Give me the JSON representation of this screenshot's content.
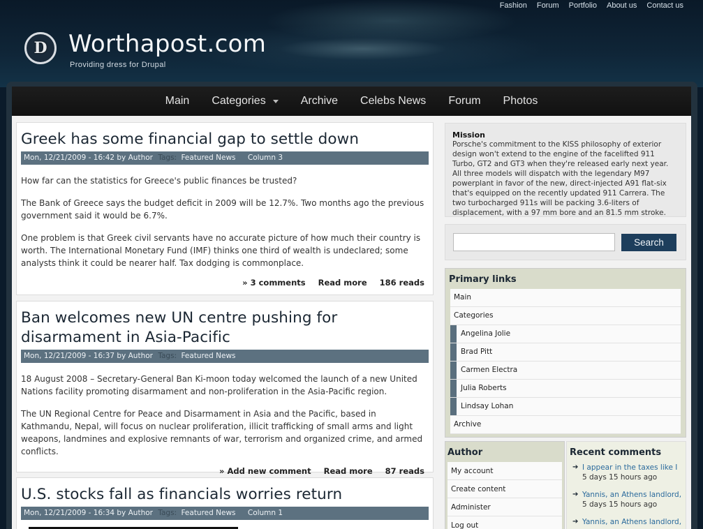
{
  "topnav": [
    "Fashion",
    "Forum",
    "Portfolio",
    "About us",
    "Contact us"
  ],
  "site": {
    "logo_letter": "D",
    "name": "Worthapost.com",
    "slogan": "Providing dress for Drupal"
  },
  "mainnav": [
    "Main",
    "Categories",
    "Archive",
    "Celebs News",
    "Forum",
    "Photos"
  ],
  "nodes": [
    {
      "title": "Greek has some financial gap to settle down",
      "submitted": "Mon, 12/21/2009 - 16:42 by Author",
      "tags_label": "Tags:",
      "terms": [
        "Featured News",
        "Column 3"
      ],
      "paragraphs": [
        "How far can the statistics for Greece's public finances be trusted?",
        "The Bank of Greece says the budget deficit in 2009 will be 12.7%. Two months ago the previous government said it would be 6.7%.",
        "One problem is that Greek civil servants have no accurate picture of how much their country is worth. The International Monetary Fund (IMF) thinks one third of wealth is undeclared; some analysts think it could be nearer half. Tax dodging is commonplace."
      ],
      "links": [
        "» 3 comments",
        "Read more",
        "186 reads"
      ]
    },
    {
      "title": "Ban welcomes new UN centre pushing for disarmament in Asia-Pacific",
      "submitted": "Mon, 12/21/2009 - 16:37 by Author",
      "tags_label": "Tags:",
      "terms": [
        "Featured News"
      ],
      "paragraphs": [
        "18 August 2008 – Secretary-General Ban Ki-moon today welcomed the launch of a new United Nations facility promoting disarmament and non-proliferation in the Asia-Pacific region.",
        "The UN Regional Centre for Peace and Disarmament in Asia and the Pacific, based in Kathmandu, Nepal, will focus on nuclear proliferation, illicit trafficking of small arms and light weapons, landmines and explosive remnants of war, terrorism and organized crime, and armed conflicts."
      ],
      "links": [
        "» Add new comment",
        "Read more",
        "87 reads"
      ]
    },
    {
      "title": "U.S. stocks fall as financials worries return",
      "submitted": "Mon, 12/21/2009 - 16:34 by Author",
      "tags_label": "Tags:",
      "terms": [
        "Featured News",
        "Column 1"
      ]
    }
  ],
  "mission": {
    "title": "Mission",
    "text": "Porsche's commitment to the KISS philosophy of exterior design won't extend to the engine of the facelifted 911 Turbo, GT2 and GT3 when they're released early next year. All three models will dispatch with the legendary M97 powerplant in favor of the new, direct-injected A91 flat-six that's equipped on the recently updated 911 Carrera. The two turbocharged 911s will be packing 3.6-liters of displacement, with a 97 mm bore and an 81.5 mm stroke."
  },
  "search": {
    "value": "",
    "button": "Search"
  },
  "primary_links": {
    "title": "Primary links",
    "items": [
      "Main",
      "Categories",
      "Angelina Jolie",
      "Brad Pitt",
      "Carmen Electra",
      "Julia Roberts",
      "Lindsay Lohan",
      "Archive"
    ]
  },
  "author_block": {
    "title": "Author",
    "items": [
      "My account",
      "Create content",
      "Administer",
      "Log out"
    ]
  },
  "recent_comments": {
    "title": "Recent comments",
    "items": [
      {
        "link": "I appear in the taxes like I",
        "time": "5 days 15 hours ago"
      },
      {
        "link": "Yannis, an Athens landlord,",
        "time": "5 days 15 hours ago"
      },
      {
        "link": "Yannis, an Athens landlord,",
        "time": ""
      }
    ]
  }
}
